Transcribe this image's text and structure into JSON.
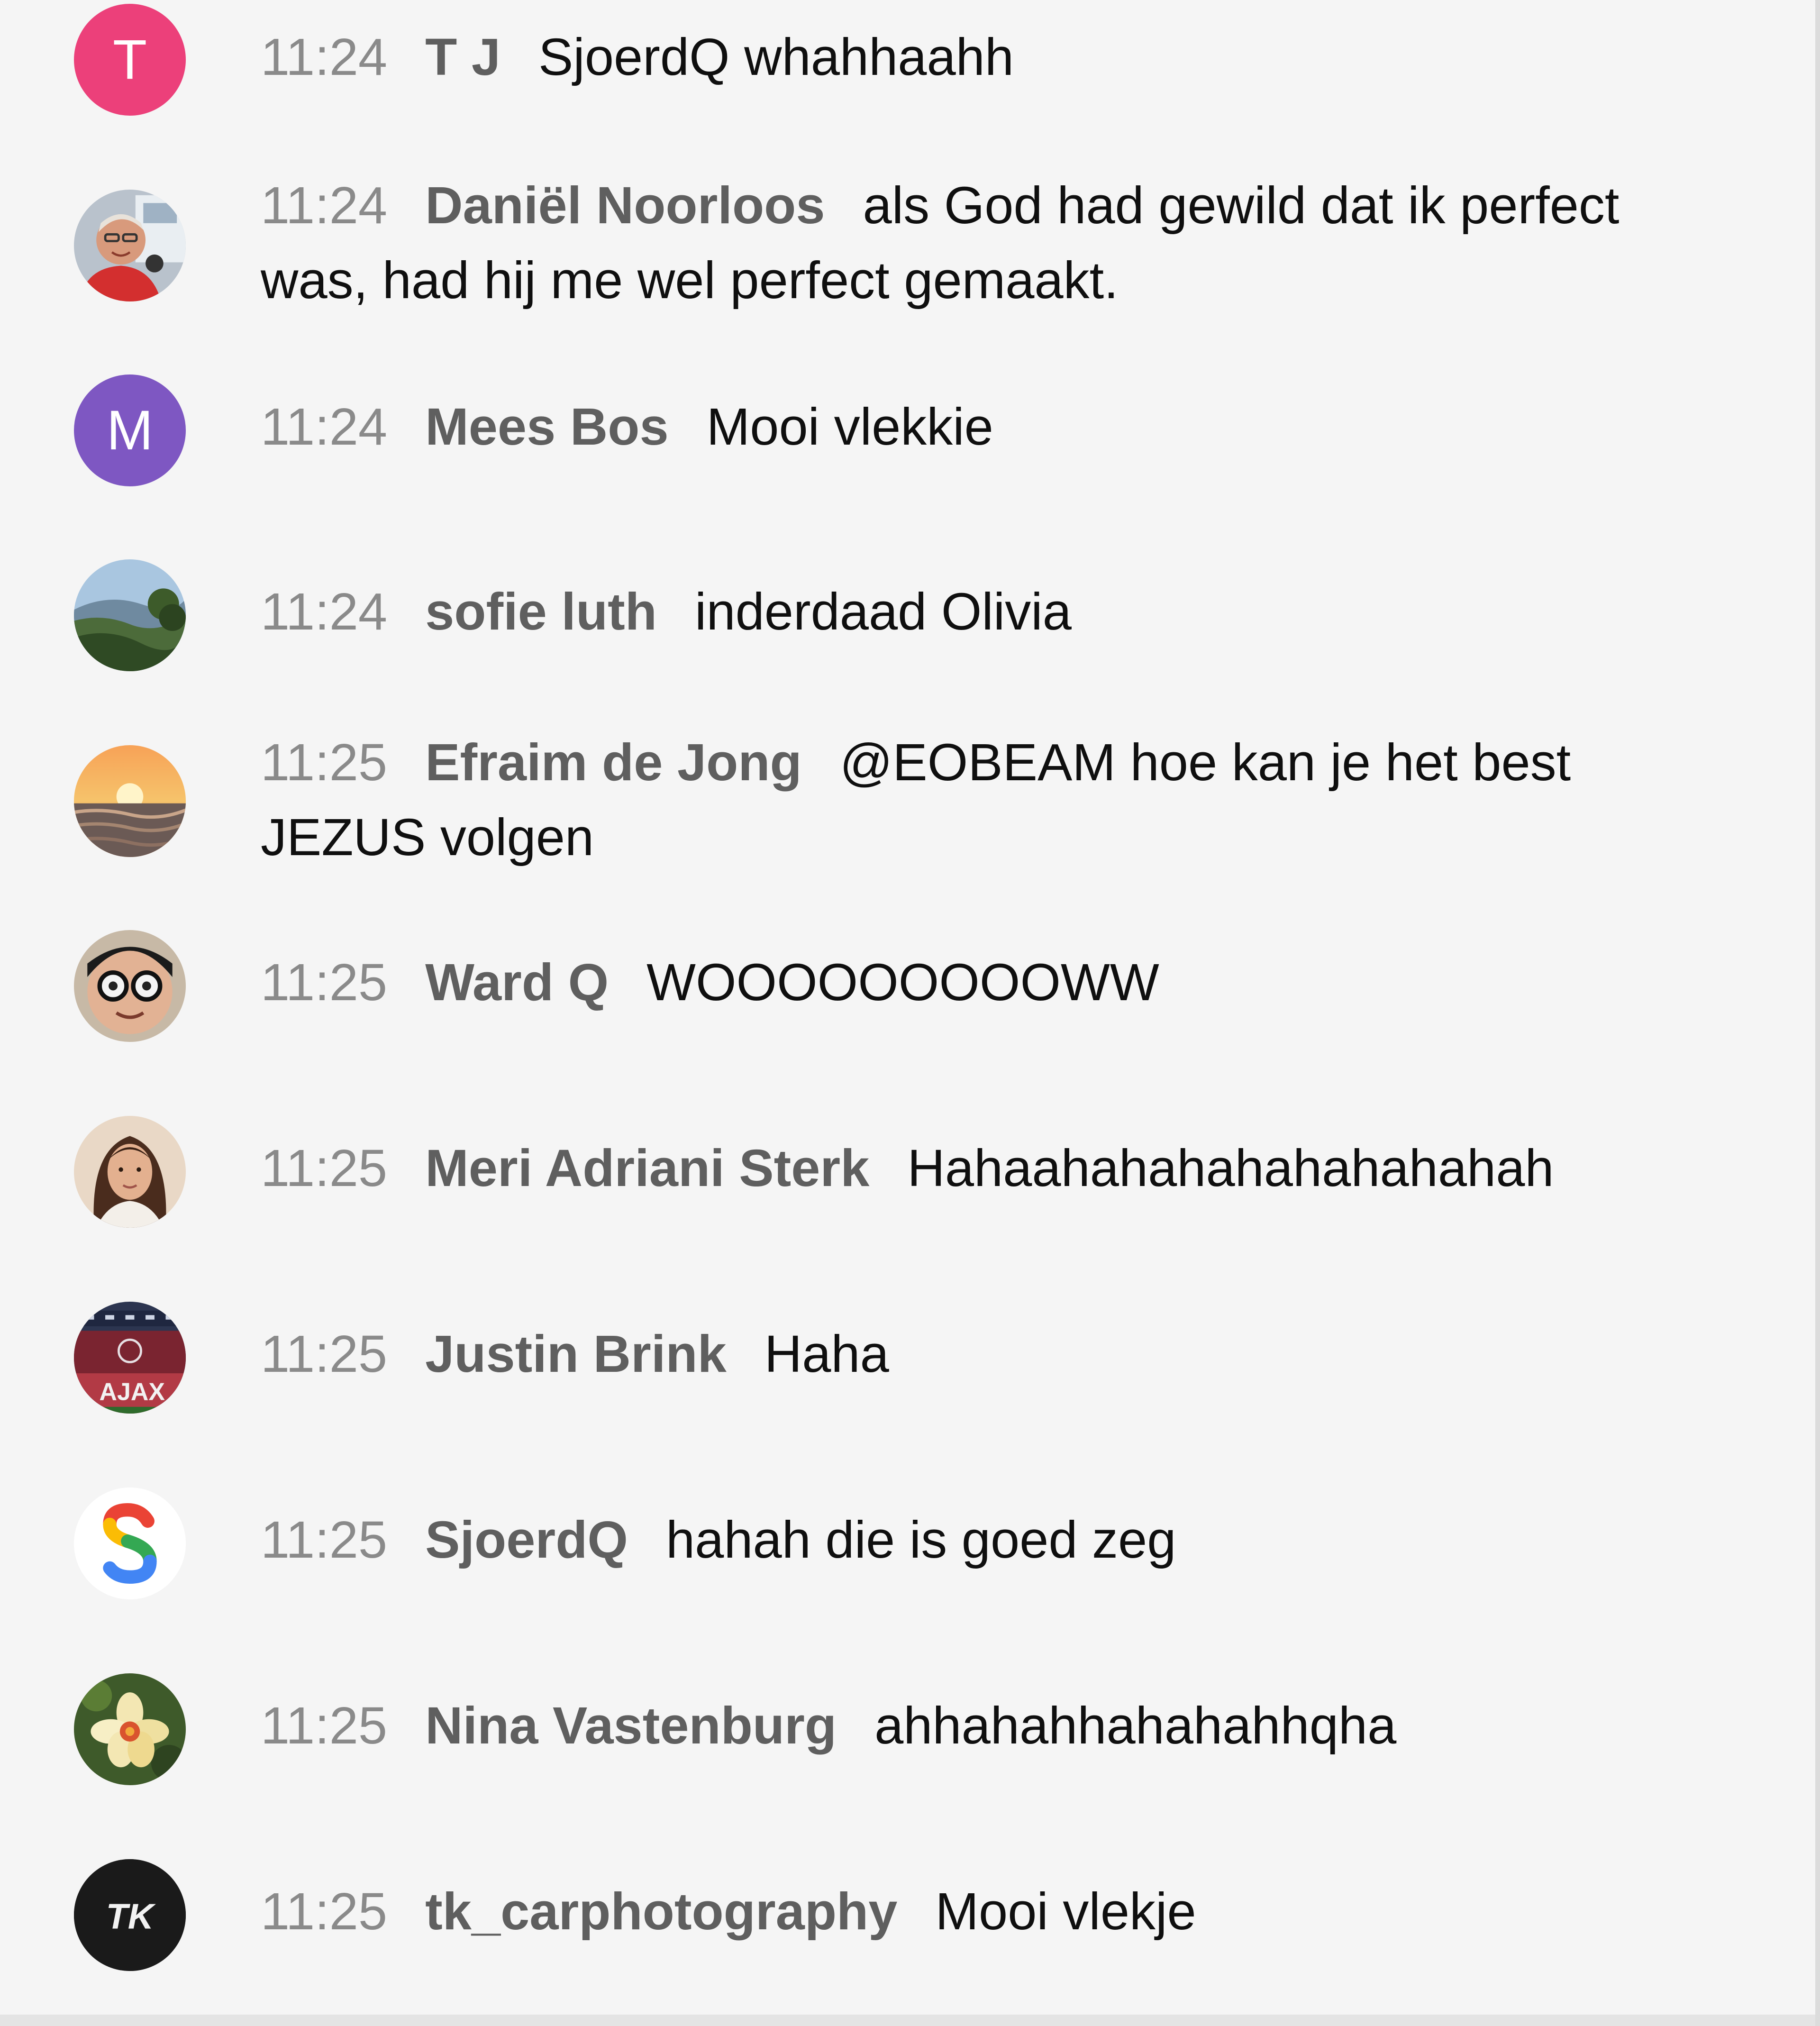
{
  "messages": [
    {
      "time": "11:24",
      "author": "T J",
      "text": "SjoerdQ whahhaahh",
      "avatar": {
        "kind": "letter",
        "letter": "T",
        "color": "#ec407a"
      }
    },
    {
      "time": "11:24",
      "author": "Daniël Noorloos",
      "text": "als God had gewild dat ik perfect was, had hij me wel perfect gemaakt.",
      "avatar": {
        "kind": "photo",
        "icon": "man-portrait-photo"
      }
    },
    {
      "time": "11:24",
      "author": "Mees Bos",
      "text": "Mooi vlekkie",
      "avatar": {
        "kind": "letter",
        "letter": "M",
        "color": "#7e57c2"
      }
    },
    {
      "time": "11:24",
      "author": "sofie luth",
      "text": "inderdaad Olivia",
      "avatar": {
        "kind": "photo",
        "icon": "landscape-photo"
      }
    },
    {
      "time": "11:25",
      "author": "Efraim de Jong",
      "text": "@EOBEAM hoe kan je het best JEZUS volgen",
      "avatar": {
        "kind": "photo",
        "icon": "sunset-photo"
      }
    },
    {
      "time": "11:25",
      "author": "Ward Q",
      "text": "WOOOOOOOOOWW",
      "avatar": {
        "kind": "photo",
        "icon": "glasses-face-photo"
      }
    },
    {
      "time": "11:25",
      "author": "Meri Adriani Sterk",
      "text": "Hahaahahahahahahahahah",
      "avatar": {
        "kind": "photo",
        "icon": "woman-portrait-photo"
      }
    },
    {
      "time": "11:25",
      "author": "Justin Brink",
      "text": "Haha",
      "avatar": {
        "kind": "photo",
        "icon": "stadium-photo",
        "logo_text": "AJAX"
      }
    },
    {
      "time": "11:25",
      "author": "SjoerdQ",
      "text": "hahah die is goed zeg",
      "avatar": {
        "kind": "logo",
        "icon": "google-s-logo"
      }
    },
    {
      "time": "11:25",
      "author": "Nina Vastenburg",
      "text": "ahhahahhahahahhqha",
      "avatar": {
        "kind": "photo",
        "icon": "flower-photo"
      }
    },
    {
      "time": "11:25",
      "author": "tk_carphotography",
      "text": "Mooi vlekje",
      "avatar": {
        "kind": "logo",
        "icon": "tk-logo",
        "logo_text": "TK"
      }
    }
  ]
}
